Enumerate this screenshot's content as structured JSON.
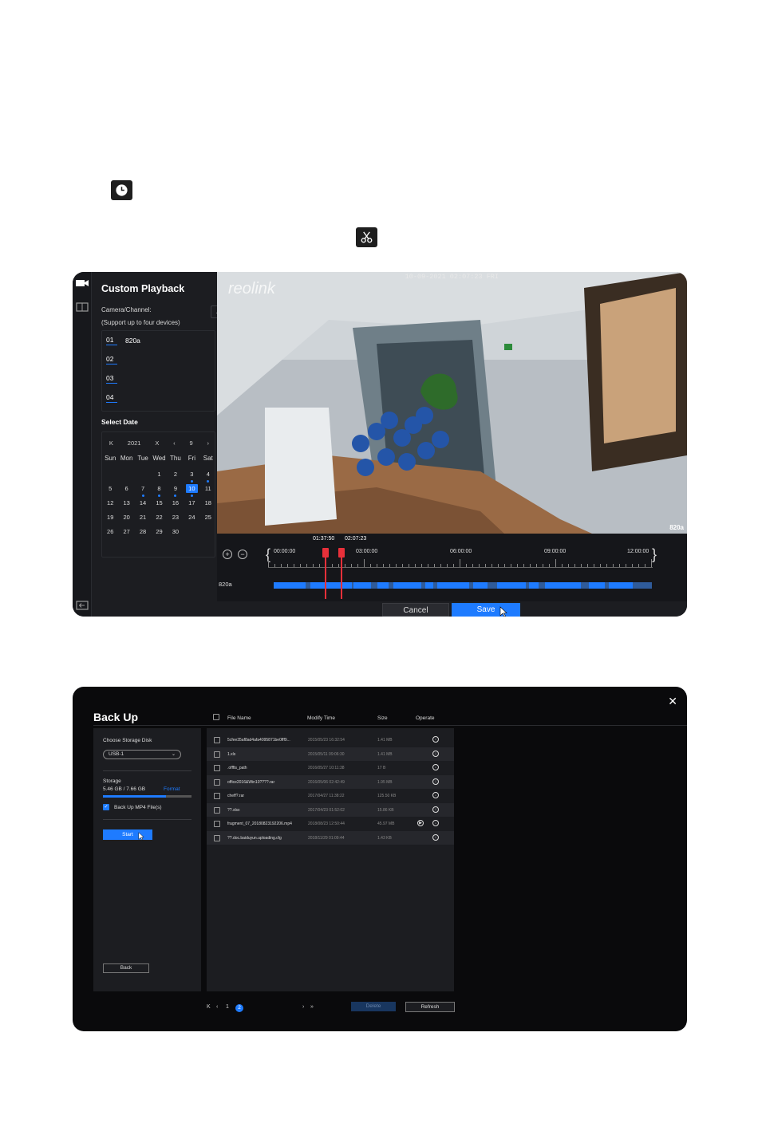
{
  "playback": {
    "title": "Custom Playback",
    "camera_label": "Camera/Channel:",
    "support_note": "(Support up to four devices)",
    "channels": [
      {
        "num": "01",
        "name": "820a"
      },
      {
        "num": "02",
        "name": ""
      },
      {
        "num": "03",
        "name": ""
      },
      {
        "num": "04",
        "name": ""
      }
    ],
    "select_date_label": "Select Date",
    "calendar": {
      "year": "2021",
      "month": "9",
      "weekdays": [
        "Sun",
        "Mon",
        "Tue",
        "Wed",
        "Thu",
        "Fri",
        "Sat"
      ],
      "selected_day": "10",
      "days_with_recordings": [
        "3",
        "4",
        "7",
        "8",
        "9",
        "10"
      ]
    },
    "osd_timestamp": "10-09-2021 02:07:23 FRI",
    "osd_logo": "reolink",
    "osd_camera": "820a",
    "timeline": {
      "ticks": [
        "00:00:00",
        "03:00:00",
        "06:00:00",
        "09:00:00",
        "12:00:00"
      ],
      "selection_start": "01:37:50",
      "selection_end": "02:07:23",
      "camera_row_label": "820a"
    },
    "cancel_label": "Cancel",
    "save_label": "Save"
  },
  "backup": {
    "title": "Back Up",
    "choose_disk_label": "Choose Storage Disk",
    "disk_value": "USB-1",
    "storage_label": "Storage",
    "storage_value": "5.46 GB / 7.66 GB",
    "storage_used_fraction": 0.713,
    "format_label": "Format",
    "mp4_checkbox_label": "Back Up MP4 File(s)",
    "mp4_checked": true,
    "start_label": "Start",
    "back_label": "Back",
    "columns": {
      "name": "File Name",
      "time": "Modify Time",
      "size": "Size",
      "operate": "Operate"
    },
    "files": [
      {
        "name": "5cfee35af8ad4afa4095871be0fff9...",
        "time": "2015/05/23 16:32:54",
        "size": "1.41 MB",
        "video": false
      },
      {
        "name": "1.xls",
        "time": "2015/05/11 09:06:30",
        "size": "1.41 MB",
        "video": false
      },
      {
        "name": ".offfts_path",
        "time": "2016/05/27 10:11:38",
        "size": "17 B",
        "video": false
      },
      {
        "name": "office2016&Win10????.rar",
        "time": "2016/05/06 02:42:49",
        "size": "1.95 MB",
        "video": false
      },
      {
        "name": "cheff?.rar",
        "time": "2017/04/27 11:38:22",
        "size": "125.50 KB",
        "video": false
      },
      {
        "name": "??.xlsx",
        "time": "2017/04/23 01:52:02",
        "size": "15.86 KB",
        "video": false
      },
      {
        "name": "fragment_07_20180823192206.mp4",
        "time": "2018/08/23 12:50:44",
        "size": "45.97 MB",
        "video": true
      },
      {
        "name": "??.doc.baiduyun.uploading.cfg",
        "time": "2018/11/29 01:09:44",
        "size": "1.43 KB",
        "video": false
      }
    ],
    "pager": {
      "page1": "1",
      "page2": "2"
    },
    "delete_label": "Delete",
    "refresh_label": "Refresh"
  }
}
